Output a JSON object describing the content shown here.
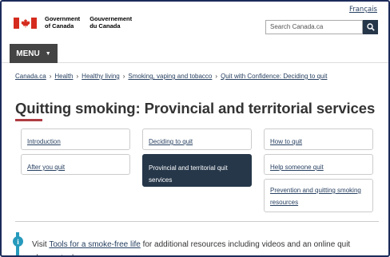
{
  "header": {
    "language_link": "Français",
    "goc_en_line1": "Government",
    "goc_en_line2": "of Canada",
    "goc_fr_line1": "Gouvernement",
    "goc_fr_line2": "du Canada",
    "search_placeholder": "Search Canada.ca",
    "menu_label": "MENU"
  },
  "breadcrumb": [
    "Canada.ca",
    "Health",
    "Healthy living",
    "Smoking, vaping and tobacco",
    "Quit with Confidence: Deciding to quit"
  ],
  "page_title": "Quitting smoking: Provincial and territorial services",
  "nav_cards": {
    "introduction": "Introduction",
    "deciding": "Deciding to quit",
    "how_to_quit": "How to quit",
    "after_you_quit": "After you quit",
    "provincial": "Provincial and territorial quit services",
    "help_someone": "Help someone quit",
    "prevention": "Prevention and quitting smoking resources"
  },
  "alert": {
    "prefix": "Visit ",
    "link": "Tools for a smoke-free life",
    "suffix": " for additional resources including videos and an online quit planner tool."
  },
  "colors": {
    "flag_red": "#d52b1e",
    "nav_dark": "#26374a",
    "link": "#284162",
    "title_accent": "#af3c43",
    "info": "#269abc"
  }
}
